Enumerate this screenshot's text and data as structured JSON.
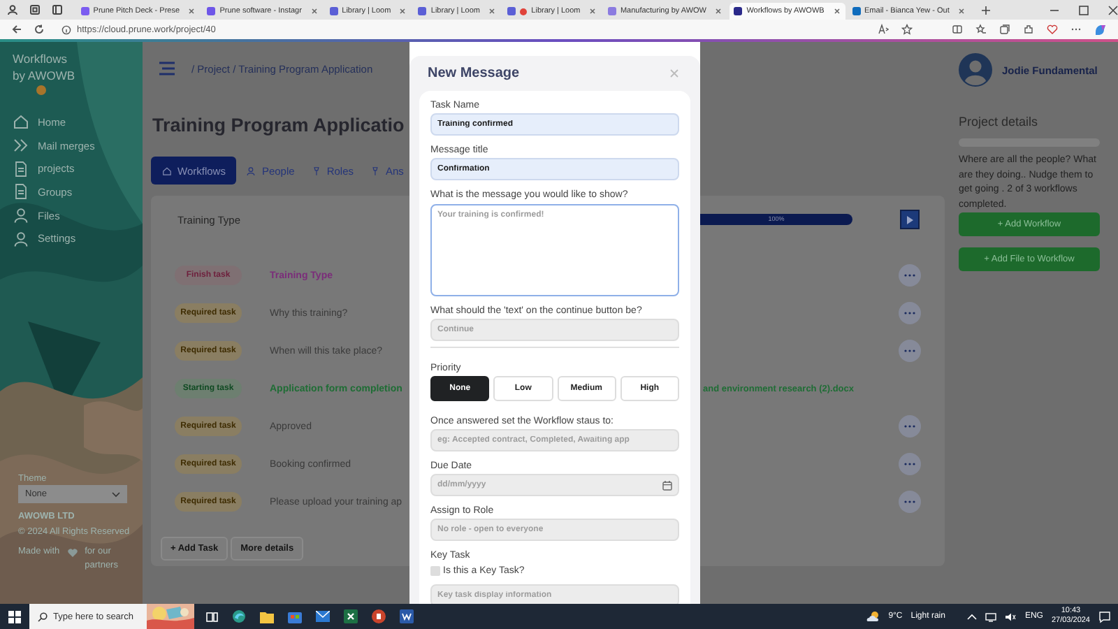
{
  "browser": {
    "tabs": [
      {
        "title": "Prune Pitch Deck - Prese",
        "color": "#7b5cf0",
        "recording": false,
        "selected": false
      },
      {
        "title": "Prune software - Instagr",
        "color": "#6e56e8",
        "recording": false,
        "selected": false
      },
      {
        "title": "Library | Loom",
        "color": "#5b5fd6",
        "recording": false,
        "selected": false
      },
      {
        "title": "Library | Loom",
        "color": "#5b5fd6",
        "recording": false,
        "selected": false
      },
      {
        "title": "Library | Loom",
        "color": "#5b5fd6",
        "recording": true,
        "selected": false
      },
      {
        "title": "Manufacturing by AWOW",
        "color": "#8b7be0",
        "recording": false,
        "selected": false
      },
      {
        "title": "Workflows by AWOWB",
        "color": "#2b2a8a",
        "recording": false,
        "selected": true
      },
      {
        "title": "Email - Bianca Yew - Out",
        "color": "#0f6cbd",
        "recording": false,
        "selected": false
      }
    ],
    "url": "https://cloud.prune.work/project/40"
  },
  "sidebar": {
    "brand": [
      "Workflows",
      "by AWOWB"
    ],
    "items": [
      {
        "kind": "home",
        "label": "Home"
      },
      {
        "kind": "merge",
        "label": "Mail merges"
      },
      {
        "kind": "document",
        "label": "projects"
      },
      {
        "kind": "document",
        "label": "Groups"
      },
      {
        "kind": "person",
        "label": "Files"
      },
      {
        "kind": "person",
        "label": "Settings"
      }
    ],
    "theme": {
      "label": "Theme",
      "value": "None"
    },
    "company": "AWOWB LTD",
    "copyright": "© 2024 All Rights Reserved",
    "made_with": "Made with",
    "made_for": "for our partners"
  },
  "header": {
    "breadcrumb": "/ Project / Training Program Application",
    "title": "Training Program Applicatio"
  },
  "tabs": [
    {
      "kind": "home",
      "label": "Workflows",
      "selected": true
    },
    {
      "kind": "person",
      "label": "People",
      "selected": false
    },
    {
      "kind": "pin",
      "label": "Roles",
      "selected": false
    },
    {
      "kind": "pin",
      "label": "Ans",
      "selected": false
    }
  ],
  "workflow": {
    "name": "Training Type",
    "progress_label": "100%",
    "level": 1,
    "tasks": [
      {
        "kind": "finish",
        "badge": "Finish task",
        "title": "Training Type",
        "menu": true
      },
      {
        "kind": "required",
        "badge": "Required task",
        "title": "Why this training?",
        "menu": true
      },
      {
        "kind": "required",
        "badge": "Required task",
        "title": "When will this take place?",
        "menu": true
      },
      {
        "kind": "starting",
        "badge": "Starting task",
        "title": "Application form completion",
        "attachment": "and environment research (2).docx",
        "menu": false
      },
      {
        "kind": "required",
        "badge": "Required task",
        "title": "Approved",
        "menu": true
      },
      {
        "kind": "required",
        "badge": "Required task",
        "title": "Booking confirmed",
        "menu": true
      },
      {
        "kind": "required",
        "badge": "Required task",
        "title": "Please upload your training ap",
        "menu": true
      }
    ],
    "buttons": [
      "+ Add Task",
      "More details"
    ]
  },
  "modal": {
    "title": "New Message",
    "fields": [
      {
        "kind": "input",
        "label": "Task Name",
        "value": "Training confirmed"
      },
      {
        "kind": "input",
        "label": "Message title",
        "value": "Confirmation"
      },
      {
        "kind": "textarea",
        "label": "What is the message you would like to show?",
        "placeholder": "Your training is confirmed!"
      },
      {
        "kind": "input",
        "label": "What should the 'text' on the continue button be?",
        "placeholder": "Continue"
      },
      {
        "kind": "priority",
        "label": "Priority",
        "options": [
          {
            "label": "None",
            "selected": true
          },
          {
            "label": "Low",
            "selected": false
          },
          {
            "label": "Medium",
            "selected": false
          },
          {
            "label": "High",
            "selected": false
          }
        ]
      },
      {
        "kind": "input",
        "label": "Once answered set the Workflow staus to:",
        "placeholder": "eg: Accepted contract, Completed, Awaiting app"
      },
      {
        "kind": "date",
        "label": "Due Date",
        "placeholder": "dd/mm/yyyy"
      },
      {
        "kind": "select",
        "label": "Assign to Role",
        "placeholder": "No role - open to everyone"
      },
      {
        "kind": "checkbox",
        "label": "Key Task",
        "text": "Is this a Key Task?",
        "checked": false
      },
      {
        "kind": "input",
        "placeholder": "Key task display information"
      }
    ]
  },
  "user": {
    "name": "Jodie Fundamental"
  },
  "project_details": {
    "title": "Project details",
    "level": 0,
    "note": "Where are all the people? What are they doing.. Nudge them to get going . 2 of 3 workflows completed.",
    "buttons": [
      "+ Add Workflow",
      "+ Add File to Workflow"
    ]
  },
  "taskbar": {
    "search_placeholder": "Type here to search",
    "temperature": "9°C",
    "weather": "Light rain",
    "language": "ENG",
    "time": "10:43",
    "date": "27/03/2024"
  }
}
